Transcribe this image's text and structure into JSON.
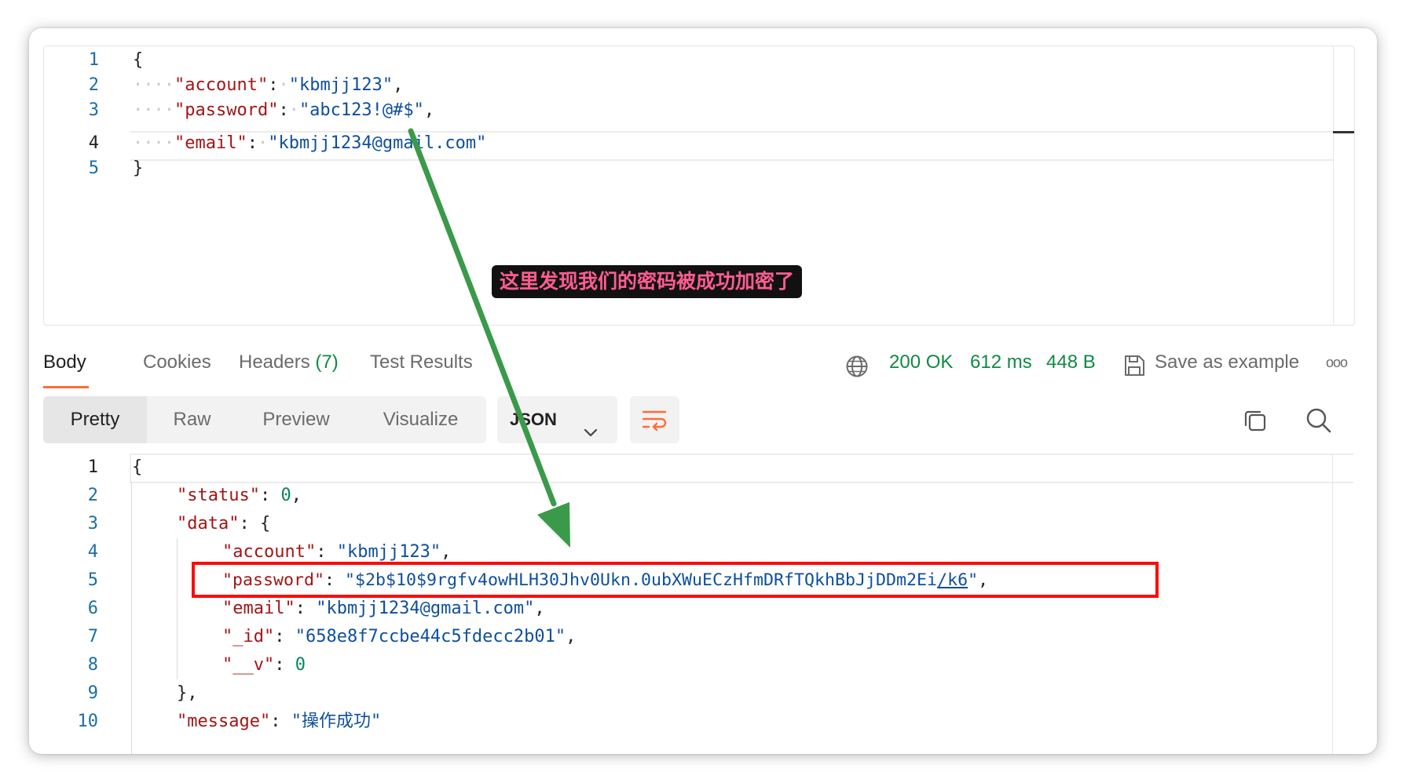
{
  "annotation": {
    "callout_text": "这里发现我们的密码被成功加密了"
  },
  "request_body": {
    "line_numbers": [
      "1",
      "2",
      "3",
      "4",
      "5"
    ],
    "open_brace": "{",
    "close_brace": "}",
    "fields": [
      {
        "key": "\"account\"",
        "value": "\"kbmjj123\"",
        "trail": ","
      },
      {
        "key": "\"password\"",
        "value": "\"abc123!@#$\"",
        "trail": ","
      },
      {
        "key": "\"email\"",
        "value": "\"kbmjj1234@gmail.com\"",
        "trail": ""
      }
    ]
  },
  "response_tabs": [
    {
      "label": "Body"
    },
    {
      "label": "Cookies"
    },
    {
      "label": "Headers",
      "count": "(7)"
    },
    {
      "label": "Test Results"
    }
  ],
  "response_status": {
    "status": "200 OK",
    "time": "612 ms",
    "size": "448 B",
    "save_label": "Save as example",
    "more_label": "ooo"
  },
  "view_modes": [
    "Pretty",
    "Raw",
    "Preview",
    "Visualize"
  ],
  "format_select": {
    "value": "JSON"
  },
  "icons": {
    "globe": "globe-icon",
    "save": "save-icon",
    "more": "more-icon",
    "chevron": "chevron-down-icon",
    "wrap": "wrap-lines-icon",
    "copy": "copy-icon",
    "search": "search-icon"
  },
  "colors": {
    "accent": "#ff6c37",
    "status_green": "#0f8a44",
    "highlight_red": "#ff0a0a",
    "arrow_green": "#3a9a4a",
    "callout_text": "#ff5c93"
  },
  "response_body": {
    "line_numbers": [
      "1",
      "2",
      "3",
      "4",
      "5",
      "6",
      "7",
      "8",
      "9",
      "10"
    ],
    "open_brace": "{",
    "status_key": "\"status\"",
    "status_val": "0",
    "data_key": "\"data\"",
    "data_open": "{",
    "account_key": "\"account\"",
    "account_val": "\"kbmjj123\"",
    "password_key": "\"password\"",
    "password_val_a": "\"$2b$10$9rgfv4owHLH30Jhv0Ukn.0ubXWuECzHfmDRfTQkhBbJjDDm2Ei",
    "password_val_link": "/k6",
    "password_val_end": "\"",
    "email_key": "\"email\"",
    "email_val": "\"kbmjj1234@gmail.com\"",
    "id_key": "\"_id\"",
    "id_val": "\"658e8f7ccbe44c5fdecc2b01\"",
    "v_key": "\"__v\"",
    "v_val": "0",
    "data_close": "},",
    "message_key": "\"message\"",
    "message_val": "\"操作成功\""
  }
}
